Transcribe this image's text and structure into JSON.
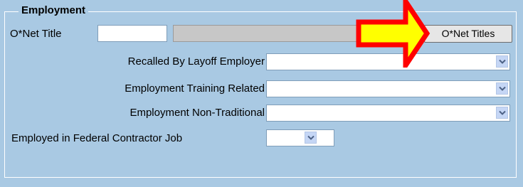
{
  "section": {
    "legend": "Employment"
  },
  "onet": {
    "label": "O*Net Title",
    "code_value": "",
    "title_value": "",
    "button_label": "O*Net Titles"
  },
  "fields": [
    {
      "label": "Recalled By Layoff Employer",
      "value": ""
    },
    {
      "label": "Employment Training Related",
      "value": ""
    },
    {
      "label": "Employment Non-Traditional",
      "value": ""
    },
    {
      "label": "Employed in Federal Contractor Job",
      "value": ""
    }
  ],
  "colors": {
    "panel_bg": "#a9c9e3",
    "arrow_fill": "#ffff00",
    "arrow_outline": "#ff0000",
    "dropdown_button": "#c5d6f5"
  },
  "icons": {
    "dropdown": "chevron-down-icon",
    "annotation": "arrow-right-icon"
  }
}
